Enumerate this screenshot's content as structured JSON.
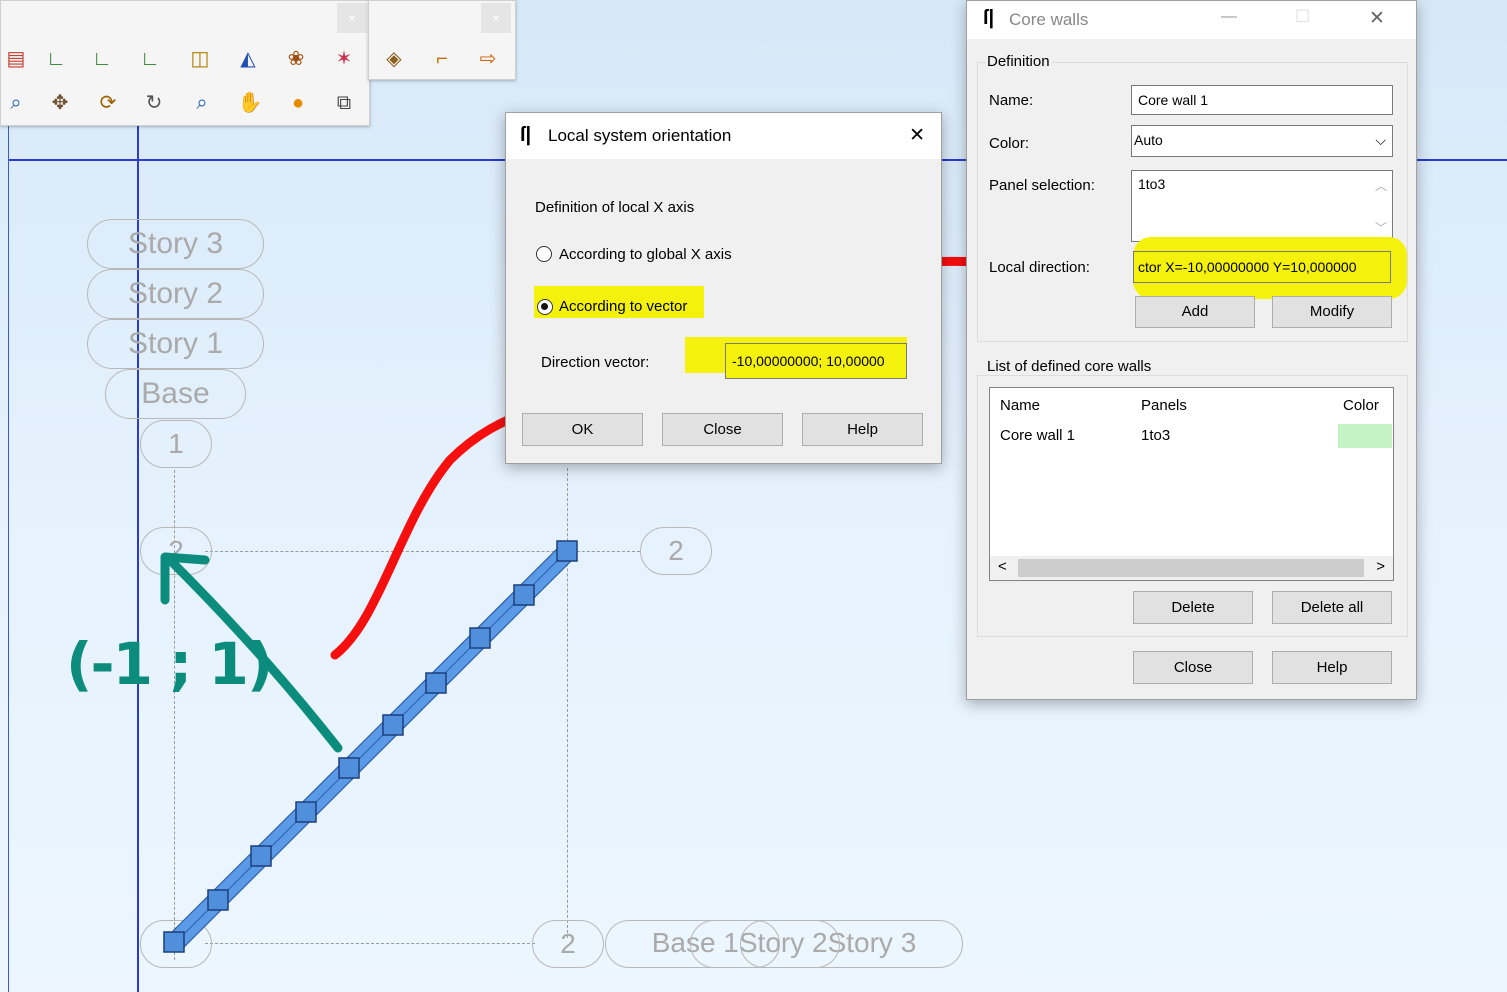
{
  "viewport": {
    "stories": [
      "Story 3",
      "Story 2",
      "Story 1",
      "Base"
    ],
    "axis_bubbles": {
      "row1": "1",
      "row2": "2",
      "col2_top": "2",
      "col2_bottom": "2"
    },
    "bottom_overlap_label": "Base 1Story 2Story 3",
    "handwritten_note": "(-1 ; 1)"
  },
  "toolbars": {
    "close_glyph": "×"
  },
  "local_dialog": {
    "title": "Local system orientation",
    "close_glyph": "✕",
    "section_label": "Definition of local X axis",
    "option_global": "According to global X axis",
    "option_vector": "According to vector",
    "direction_label": "Direction vector:",
    "direction_value": "-10,00000000; 10,00000",
    "buttons": {
      "ok": "OK",
      "close": "Close",
      "help": "Help"
    }
  },
  "core_dialog": {
    "title": "Core walls",
    "controls": {
      "minimize": "—",
      "maximize": "☐",
      "close": "✕"
    },
    "definition_group": "Definition",
    "name_label": "Name:",
    "name_value": "Core wall 1",
    "color_label": "Color:",
    "color_value": "Auto",
    "panel_label": "Panel selection:",
    "panel_value": "1to3",
    "local_label": "Local direction:",
    "local_value": "ctor X=-10,00000000 Y=10,000000",
    "add_button": "Add",
    "modify_button": "Modify",
    "list_group": "List of defined core walls",
    "table": {
      "headers": [
        "Name",
        "Panels",
        "Color"
      ],
      "rows": [
        {
          "name": "Core wall 1",
          "panels": "1to3",
          "color": "#c6f3c6"
        }
      ]
    },
    "delete_button": "Delete",
    "delete_all_button": "Delete all",
    "close_button": "Close",
    "help_button": "Help"
  },
  "colors": {
    "highlight": "#f4f20c",
    "red_arrow": "#f50f0f",
    "teal_arrow": "#0c8c7c",
    "wall_fill": "#5b9ae6",
    "axis_blue": "#2a3cc8"
  }
}
